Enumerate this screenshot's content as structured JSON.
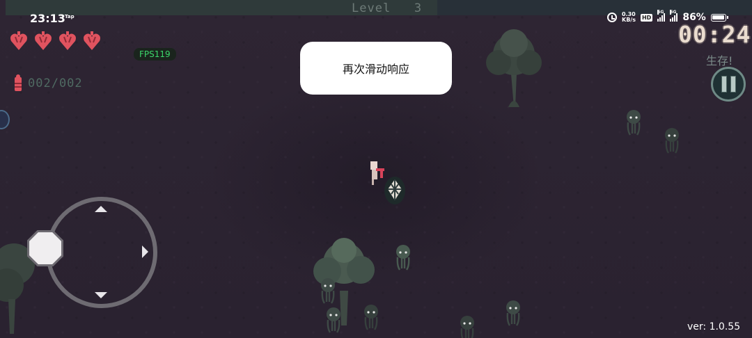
{
  "status_bar": {
    "time": "23:13",
    "time_tag": "Tap",
    "net_speed_value": "0.30",
    "net_speed_unit": "KB/s",
    "hd_label": "HD",
    "signal1_label": "5G",
    "signal2_label": "5G",
    "battery_percent": "86%"
  },
  "hud": {
    "level_label": "Level",
    "level_value": "3",
    "fps": "FPS119",
    "ammo": "002/002",
    "timer": "00:24",
    "objective": "生存!",
    "version": "ver: 1.0.55",
    "hearts_count": 4
  },
  "toast": {
    "message": "再次滑动响应"
  },
  "colors": {
    "background": "#2b2230",
    "heart": "#e0535f",
    "fps_text": "#3cd66a",
    "timer_text": "#eadccf"
  },
  "icons": {
    "heart": "heart-icon",
    "bullet": "bullet-icon",
    "pause": "pause-icon",
    "alarm": "alarm-icon",
    "battery": "battery-icon",
    "signal": "signal-icon"
  }
}
